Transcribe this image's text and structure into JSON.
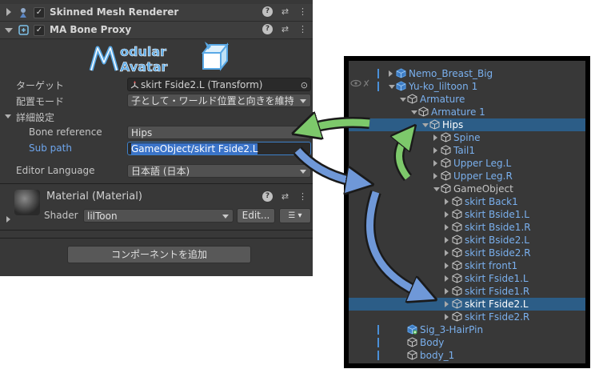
{
  "inspector": {
    "components": [
      {
        "title": "Skinned Mesh Renderer",
        "expanded": false,
        "enabled": true
      },
      {
        "title": "MA Bone Proxy",
        "expanded": true,
        "enabled": true
      }
    ],
    "logo_text": "Modular Avatar",
    "properties": {
      "target_label": "ターゲット",
      "target_value": "skirt Fside2.L (Transform)",
      "placement_label": "配置モード",
      "placement_value": "子として・ワールド位置と向きを維持",
      "advanced_label": "詳細設定",
      "bone_reference_label": "Bone reference",
      "bone_reference_value": "Hips",
      "sub_path_label": "Sub path",
      "sub_path_value": "GameObject/skirt Fside2.L",
      "editor_language_label": "Editor Language",
      "editor_language_value": "日本語 (日本)"
    },
    "material": {
      "title": "Material (Material)",
      "shader_label": "Shader",
      "shader_value": "lilToon",
      "edit_button": "Edit..."
    },
    "add_component_button": "コンポーネントを追加"
  },
  "hierarchy": {
    "rows": [
      {
        "name": "Nemo_Breast_Big",
        "depth": 0,
        "expander": "closed",
        "prefab": true,
        "icon": "prefab-cube-icon"
      },
      {
        "name": "Yu-ko_liltoon 1",
        "depth": 0,
        "expander": "open",
        "prefab": true,
        "icon": "prefab-cube-icon"
      },
      {
        "name": "Armature",
        "depth": 1,
        "expander": "open",
        "prefab": true,
        "icon": "gameobject-cube-icon"
      },
      {
        "name": "Armature 1",
        "depth": 2,
        "expander": "open",
        "prefab": true,
        "icon": "gameobject-cube-icon"
      },
      {
        "name": "Hips",
        "depth": 3,
        "expander": "open",
        "prefab": false,
        "icon": "gameobject-cube-icon",
        "selected": true
      },
      {
        "name": "Spine",
        "depth": 4,
        "expander": "closed",
        "prefab": true,
        "icon": "gameobject-cube-icon"
      },
      {
        "name": "Tail1",
        "depth": 4,
        "expander": "closed",
        "prefab": true,
        "icon": "gameobject-cube-icon"
      },
      {
        "name": "Upper Leg.L",
        "depth": 4,
        "expander": "closed",
        "prefab": true,
        "icon": "gameobject-cube-icon"
      },
      {
        "name": "Upper Leg.R",
        "depth": 4,
        "expander": "closed",
        "prefab": true,
        "icon": "gameobject-cube-icon"
      },
      {
        "name": "GameObject",
        "depth": 4,
        "expander": "open",
        "prefab": false,
        "icon": "gameobject-cube-icon"
      },
      {
        "name": "skirt Back1",
        "depth": 5,
        "expander": "closed",
        "prefab": true,
        "icon": "gameobject-cube-icon"
      },
      {
        "name": "skirt Bside1.L",
        "depth": 5,
        "expander": "closed",
        "prefab": true,
        "icon": "gameobject-cube-icon"
      },
      {
        "name": "skirt Bside1.R",
        "depth": 5,
        "expander": "closed",
        "prefab": true,
        "icon": "gameobject-cube-icon"
      },
      {
        "name": "skirt Bside2.L",
        "depth": 5,
        "expander": "closed",
        "prefab": true,
        "icon": "gameobject-cube-icon"
      },
      {
        "name": "skirt Bside2.R",
        "depth": 5,
        "expander": "closed",
        "prefab": true,
        "icon": "gameobject-cube-icon"
      },
      {
        "name": "skirt front1",
        "depth": 5,
        "expander": "closed",
        "prefab": true,
        "icon": "gameobject-cube-icon"
      },
      {
        "name": "skirt Fside1.L",
        "depth": 5,
        "expander": "closed",
        "prefab": true,
        "icon": "gameobject-cube-icon"
      },
      {
        "name": "skirt Fside1.R",
        "depth": 5,
        "expander": "closed",
        "prefab": true,
        "icon": "gameobject-cube-icon"
      },
      {
        "name": "skirt Fside2.L",
        "depth": 5,
        "expander": "closed",
        "prefab": false,
        "icon": "gameobject-cube-icon",
        "selected": true
      },
      {
        "name": "skirt Fside2.R",
        "depth": 5,
        "expander": "closed",
        "prefab": true,
        "icon": "gameobject-cube-icon"
      },
      {
        "name": "Sig_3-HairPin",
        "depth": 1,
        "expander": "none",
        "prefab": true,
        "icon": "prefab-add-icon"
      },
      {
        "name": "Body",
        "depth": 1,
        "expander": "none",
        "prefab": true,
        "icon": "gameobject-cube-icon"
      },
      {
        "name": "body_1",
        "depth": 1,
        "expander": "none",
        "prefab": true,
        "icon": "gameobject-cube-icon"
      }
    ]
  },
  "colors": {
    "accent_blue": "#6ea6ee",
    "selection": "#2c5d87",
    "arrow_green": "#7dc96b",
    "arrow_blue": "#6f98d8"
  }
}
